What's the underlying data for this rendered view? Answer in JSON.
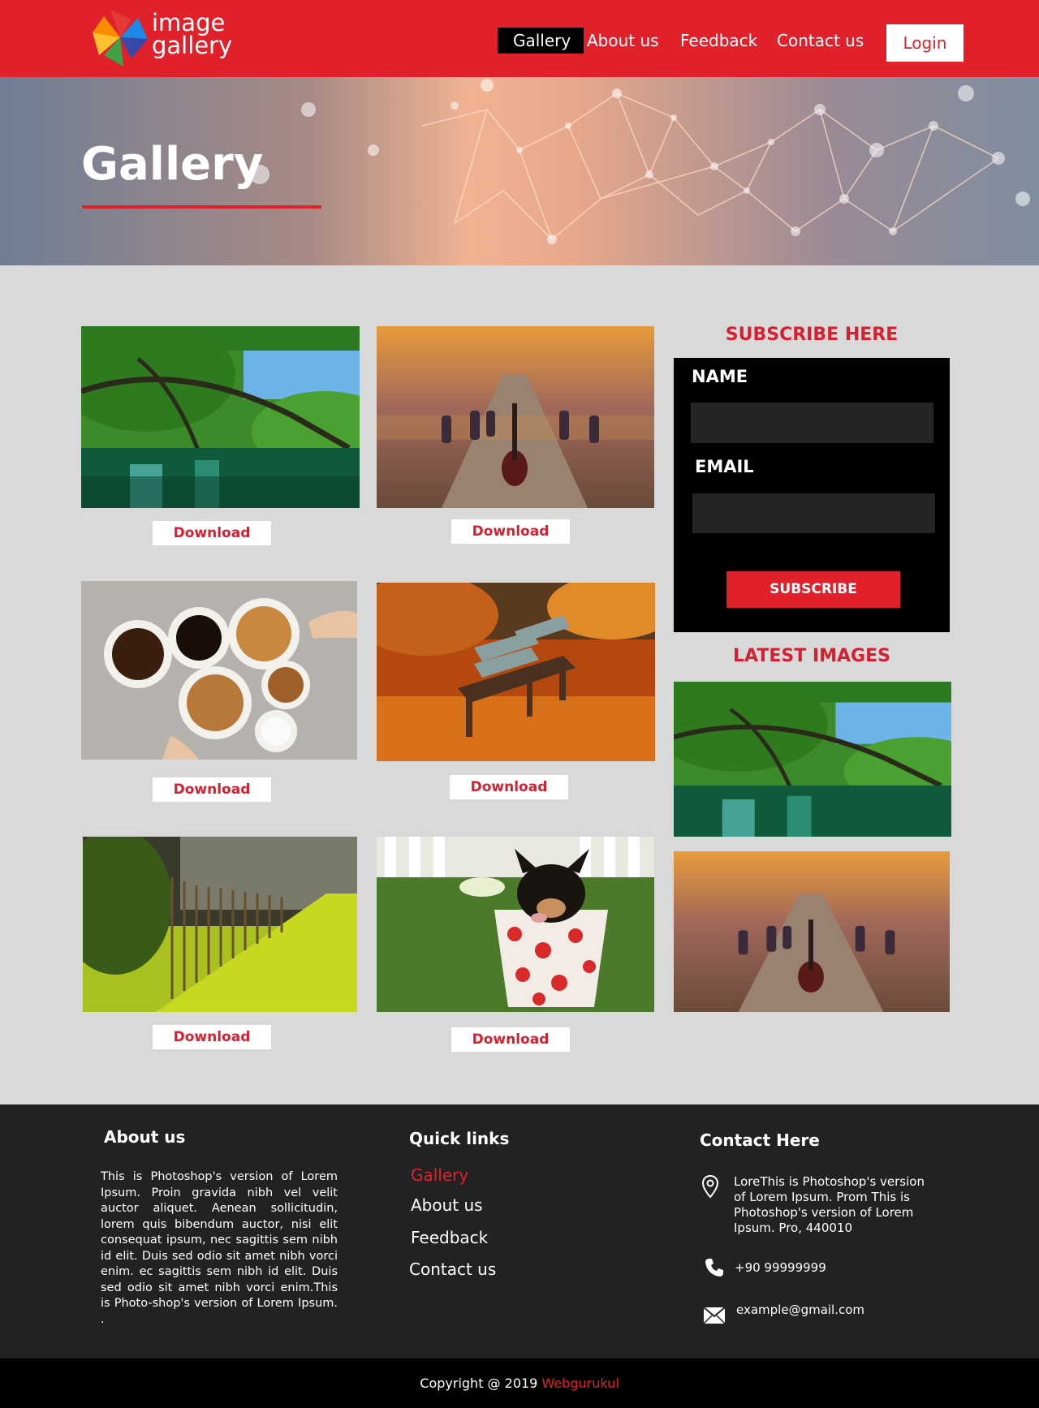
{
  "header": {
    "logo_line1": "image",
    "logo_line2": "gallery",
    "nav": [
      {
        "label": "Gallery"
      },
      {
        "label": "About us"
      },
      {
        "label": "Feedback"
      },
      {
        "label": "Contact us"
      }
    ],
    "login_label": "Login"
  },
  "hero": {
    "title": "Gallery"
  },
  "gallery": {
    "download_label": "Download",
    "images": [
      {
        "subject": "forest-river"
      },
      {
        "subject": "guitar-road"
      },
      {
        "subject": "coffee-cups"
      },
      {
        "subject": "autumn-bench"
      },
      {
        "subject": "fence-path"
      },
      {
        "subject": "puppy-cup"
      }
    ]
  },
  "subscribe": {
    "heading": "SUBSCRIBE HERE",
    "name_label": "NAME",
    "name_value": "",
    "email_label": "EMAIL",
    "email_value": "",
    "button_label": "SUBSCRIBE"
  },
  "latest": {
    "heading": "LATEST IMAGES"
  },
  "footer": {
    "about_heading": "About us",
    "about_text": "This is Photoshop's version  of Lorem Ipsum. Proin gravida nibh vel velit auctor aliquet. Aenean sollicitudin, lorem quis bibendum auctor, nisi elit consequat ipsum, nec sagittis sem nibh id elit. Duis sed odio sit amet nibh vorci enim. ec sagittis sem nibh id elit. Duis sed odio sit amet nibh vorci enim.This is Photo-shop's version  of Lorem Ipsum. .",
    "quick_heading": "Quick links",
    "quick_links": [
      {
        "label": "Gallery"
      },
      {
        "label": "About us"
      },
      {
        "label": "Feedback"
      },
      {
        "label": "Contact us"
      }
    ],
    "contact_heading": "Contact Here",
    "address": "LoreThis is Photoshop's version of Lorem Ipsum. Prom This is Photoshop's version  of Lorem Ipsum. Pro, 440010",
    "phone": "+90 99999999",
    "email": "example@gmail.com"
  },
  "copyright": {
    "prefix": "Copyright @ 2019 ",
    "brand": "Webgurukul"
  },
  "colors": {
    "accent": "#e0202b",
    "footer_bg": "#222222",
    "page_bg": "#d9d9d9"
  }
}
